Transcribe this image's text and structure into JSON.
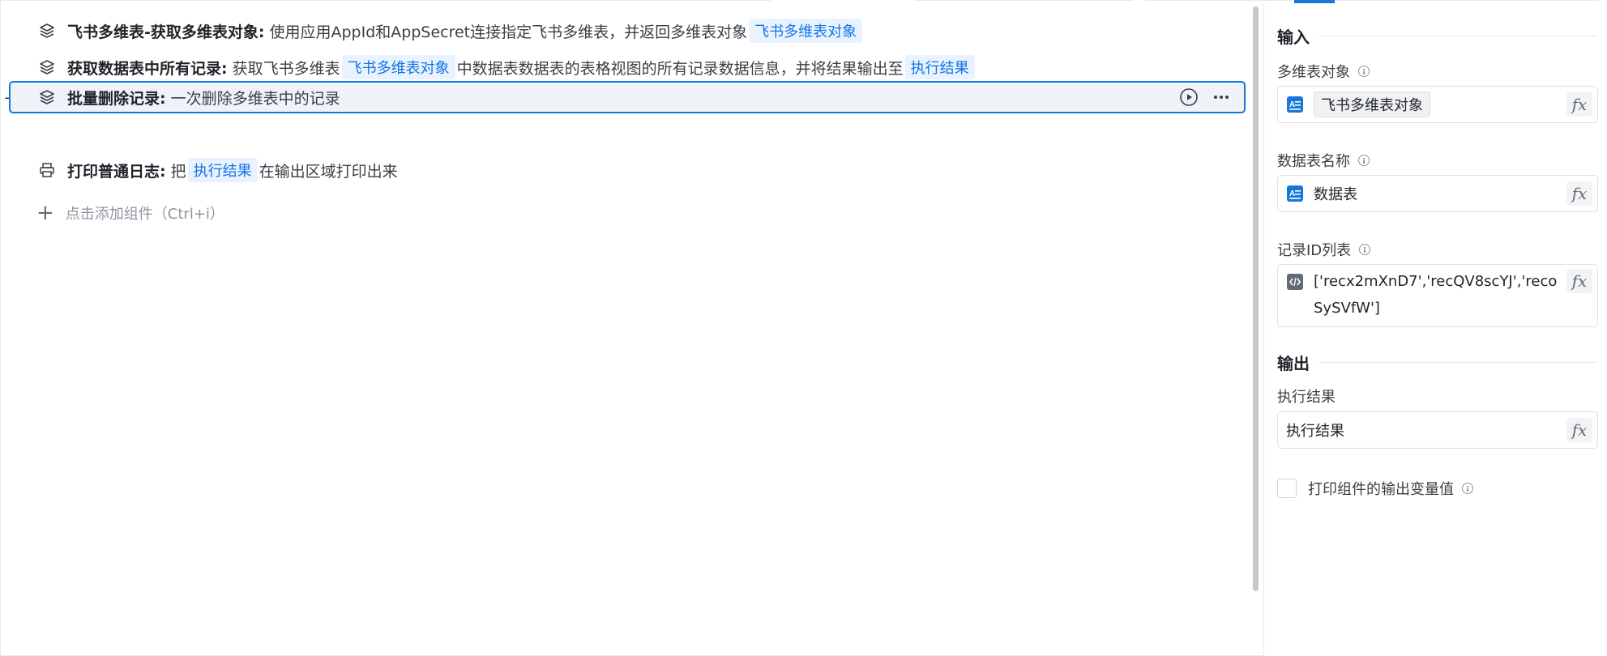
{
  "flow": {
    "steps": [
      {
        "title": "飞书多维表-获取多维表对象:",
        "desc_before": "使用应用AppId和AppSecret连接指定飞书多维表，并返回多维表对象",
        "tag1": "飞书多维表对象",
        "icon": "layers-icon"
      },
      {
        "title": "获取数据表中所有记录:",
        "desc_before": "获取飞书多维表",
        "tag1": "飞书多维表对象",
        "desc_mid": "中数据表",
        "link1": "数据表",
        "desc_after": "的表格视图的所有记录数据信息，并将结果输出至",
        "tag2": "执行结果",
        "icon": "layers-icon"
      },
      {
        "title": "批量删除记录:",
        "desc_before": "一次删除多维表中的记录",
        "icon": "layers-icon",
        "selected": true
      },
      {
        "title": "打印普通日志:",
        "desc_before": "把",
        "tag1": "执行结果",
        "desc_after": "在输出区域打印出来",
        "icon": "printer-icon"
      }
    ],
    "add_component": "点击添加组件（Ctrl+i）"
  },
  "panel": {
    "input_section": "输入",
    "fields": [
      {
        "label": "多维表对象",
        "value": "飞书多维表对象",
        "icon": "text-variable-icon"
      },
      {
        "label": "数据表名称",
        "value": "数据表",
        "icon": "text-variable-icon"
      },
      {
        "label": "记录ID列表",
        "value": "['recx2mXnD7','recQV8scYJ','recoSySVfW']",
        "icon": "code-icon"
      }
    ],
    "output_section": "输出",
    "output_field": {
      "label": "执行结果",
      "value": "执行结果"
    },
    "fx_label": "fx",
    "checkbox_label": "打印组件的输出变量值"
  },
  "colors": {
    "accent": "#1677d9",
    "tag_bg": "#e8f3ff",
    "tag_text": "#1473e6",
    "selected_bg": "#eff3f8"
  }
}
